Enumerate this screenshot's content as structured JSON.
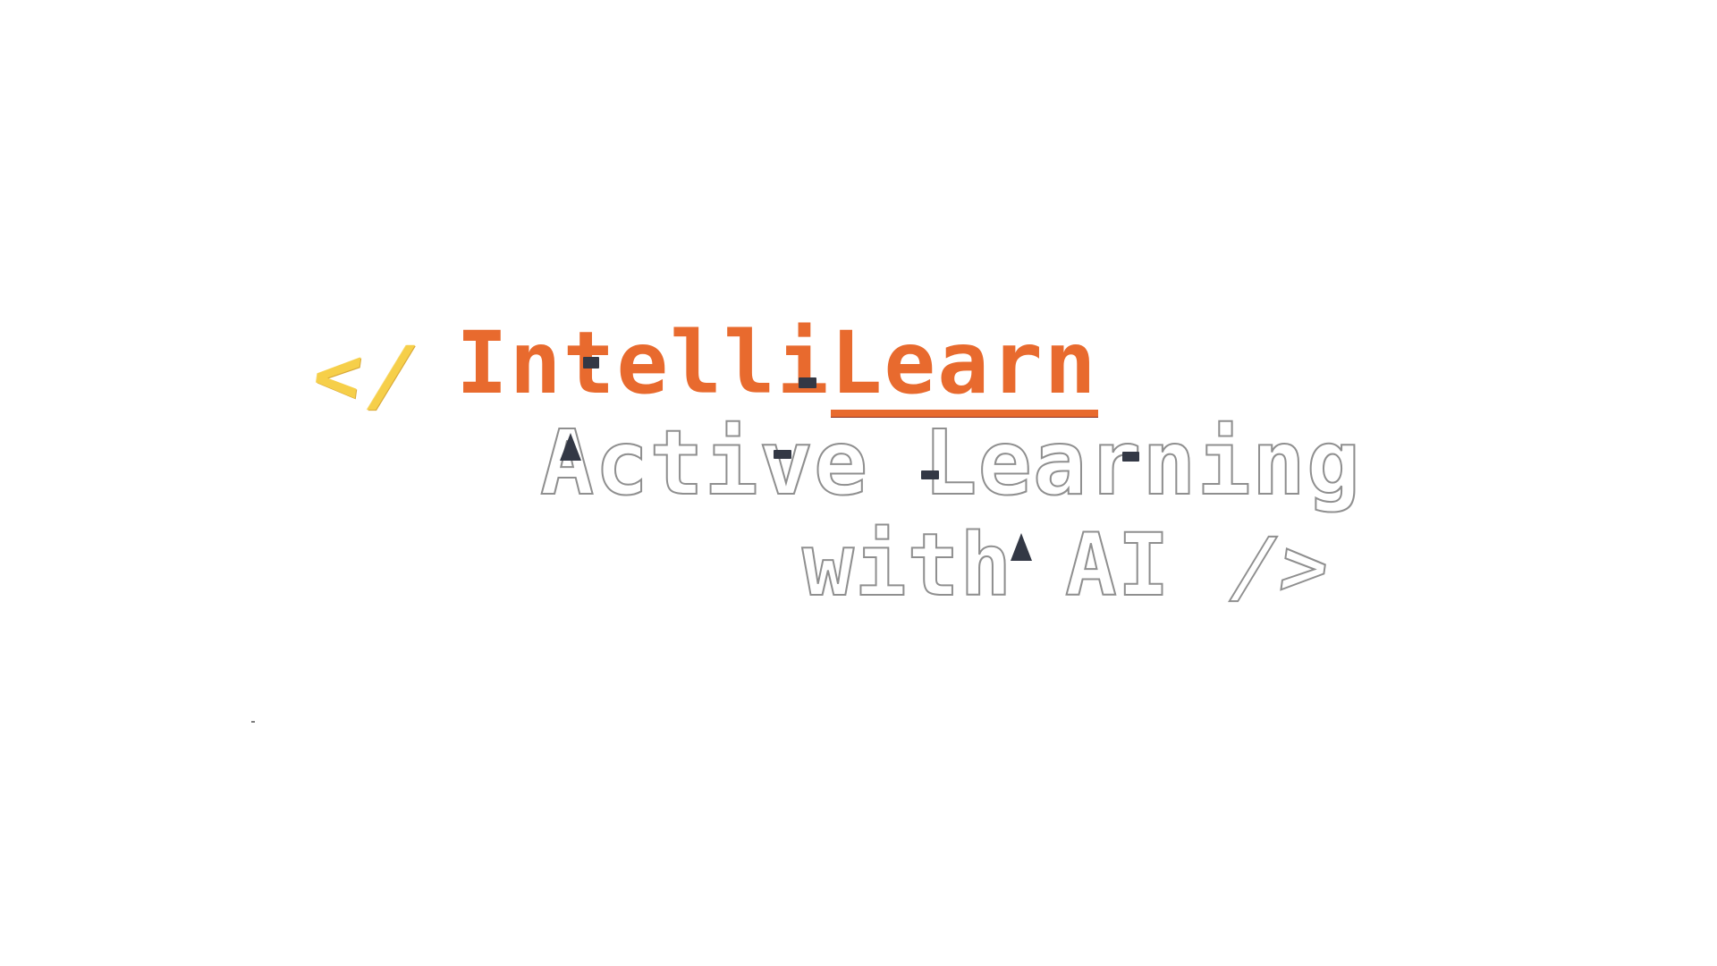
{
  "logo": {
    "open_bracket": "</",
    "brand_prefix": "Intelli",
    "brand_suffix": "Learn",
    "tagline_line_1": "Active Learning",
    "tagline_line_2": "with AI",
    "close_bracket": "/>"
  },
  "colors": {
    "background": "#ffffff",
    "bracket_yellow": "#f6cf49",
    "brand_orange": "#e86a2e",
    "outline_gray": "#8f8f8f",
    "accent_dark": "#333845"
  }
}
